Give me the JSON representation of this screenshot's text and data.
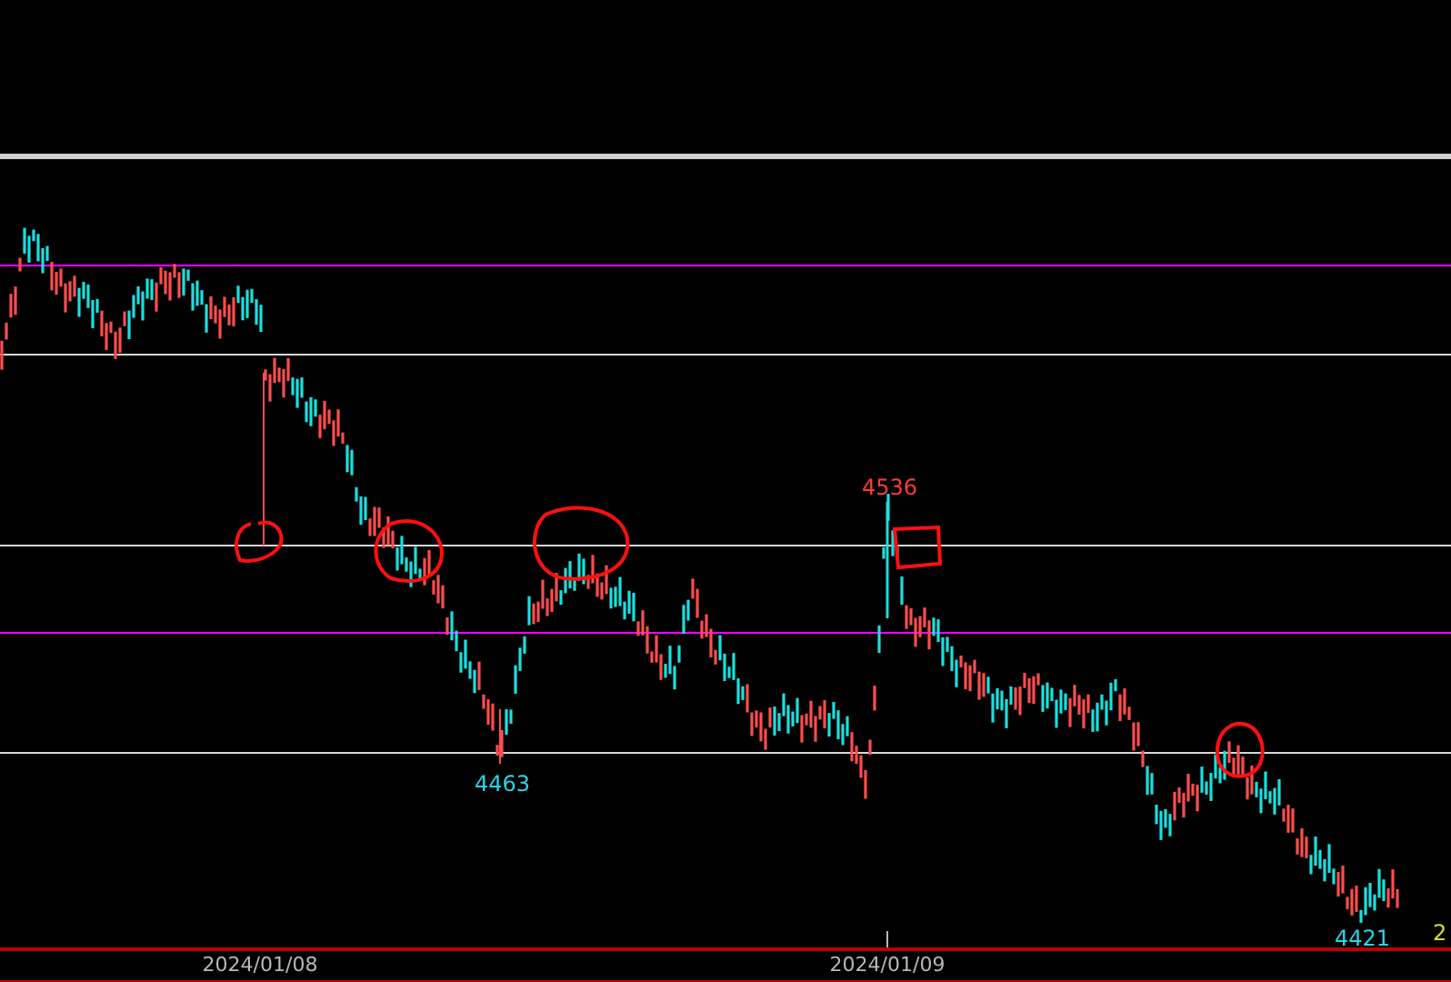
{
  "chart": {
    "price_labels": [
      {
        "text": "4536",
        "kind": "high"
      },
      {
        "text": "4463",
        "kind": "low"
      },
      {
        "text": "4421",
        "kind": "low"
      },
      {
        "text": "2",
        "kind": "cut"
      }
    ]
  },
  "time_axis": {
    "dates": [
      "2024/01/08",
      "2024/01/09"
    ]
  }
}
